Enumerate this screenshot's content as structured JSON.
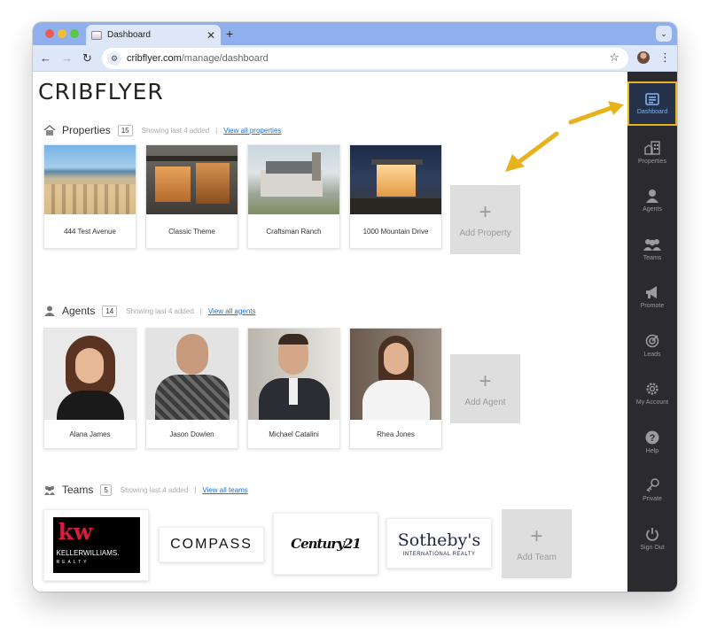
{
  "browser": {
    "tab_title": "Dashboard",
    "tab_close": "✕",
    "new_tab": "+",
    "url_domain": "cribflyer.com",
    "url_path": "/manage/dashboard"
  },
  "page": {
    "logo": "CRIBFLYER"
  },
  "properties": {
    "title": "Properties",
    "count": "15",
    "showing": "Showing last 4 added",
    "view_all": "View all properties",
    "items": [
      {
        "label": "444 Test Avenue"
      },
      {
        "label": "Classic Theme"
      },
      {
        "label": "Craftsman Ranch"
      },
      {
        "label": "1000 Mountain Drive"
      }
    ],
    "add_label": "Add Property"
  },
  "agents": {
    "title": "Agents",
    "count": "14",
    "showing": "Showing last 4 added",
    "view_all": "View all agents",
    "items": [
      {
        "label": "Alana James"
      },
      {
        "label": "Jason Dowlen"
      },
      {
        "label": "Michael Catalini"
      },
      {
        "label": "Rhea Jones"
      }
    ],
    "add_label": "Add Agent"
  },
  "teams": {
    "title": "Teams",
    "count": "5",
    "showing": "Showing last 4 added",
    "view_all": "View all teams",
    "logos": {
      "kw": "kw",
      "kw_name": "KELLERWILLIAMS.",
      "kw_sub": "REALTY",
      "compass": "COMPASS",
      "century": "Century21",
      "sothebys": "Sotheby's",
      "sothebys_sub": "INTERNATIONAL REALTY"
    },
    "add_label": "Add Team"
  },
  "sidebar": {
    "items": [
      {
        "label": "Dashboard"
      },
      {
        "label": "Properties"
      },
      {
        "label": "Agents"
      },
      {
        "label": "Teams"
      },
      {
        "label": "Promote"
      },
      {
        "label": "Leads"
      },
      {
        "label": "My Account"
      },
      {
        "label": "Help"
      },
      {
        "label": "Private"
      },
      {
        "label": "Sign Out"
      }
    ]
  },
  "colors": {
    "accent": "#e8b21c",
    "link": "#1a6fd1",
    "sidebar_bg": "#2b2b2f",
    "active_label": "#7eb3f5"
  }
}
